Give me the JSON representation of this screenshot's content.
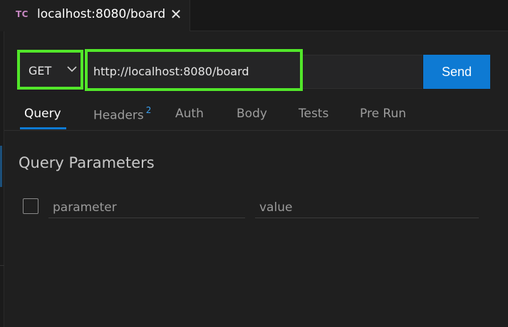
{
  "tab": {
    "badge": "TC",
    "title": "localhost:8080/board",
    "close_glyph": "✕",
    "close_icon": "close-icon"
  },
  "request": {
    "method": "GET",
    "url": "http://localhost:8080/board",
    "send_label": "Send",
    "chevron_icon": "chevron-down-icon"
  },
  "tabs": [
    {
      "label": "Query",
      "active": true
    },
    {
      "label": "Headers",
      "count": "2"
    },
    {
      "label": "Auth"
    },
    {
      "label": "Body"
    },
    {
      "label": "Tests"
    },
    {
      "label": "Pre Run"
    }
  ],
  "query": {
    "title": "Query Parameters",
    "param_placeholder": "parameter",
    "value_placeholder": "value"
  },
  "colors": {
    "highlight": "#52e62a",
    "accent": "#0e7ad3",
    "badge": "#c586c0"
  }
}
